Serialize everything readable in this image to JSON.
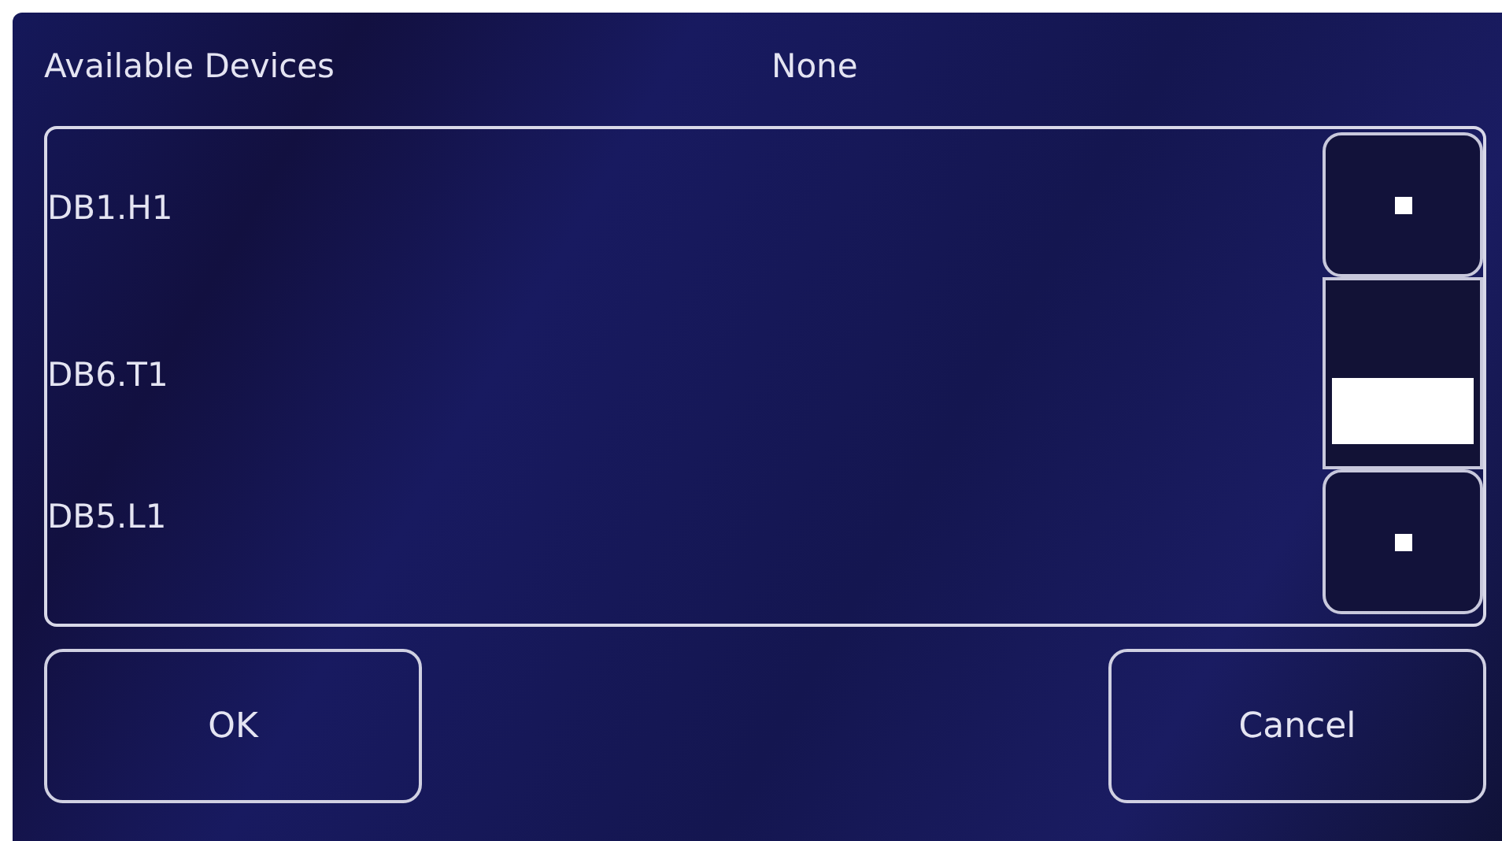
{
  "header": {
    "title": "Available Devices",
    "selection": "None"
  },
  "devices": [
    {
      "label": "DB1.H1"
    },
    {
      "label": "DB6.T1"
    },
    {
      "label": "DB5.L1"
    }
  ],
  "buttons": [
    "OK",
    "Cancel"
  ]
}
